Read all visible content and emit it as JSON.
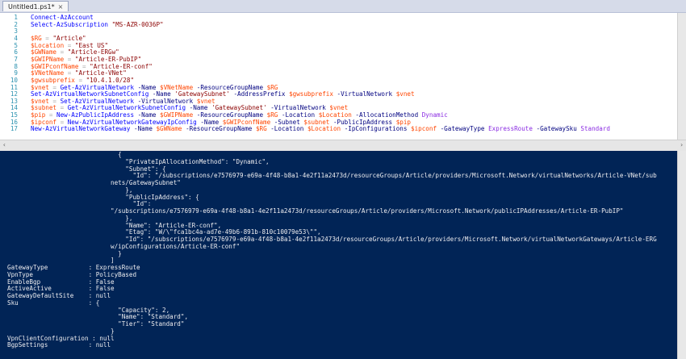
{
  "tab": {
    "title": "Untitled1.ps1*",
    "close": "×"
  },
  "editor_lines": [
    {
      "n": "1",
      "tokens": [
        {
          "c": "cmd",
          "t": "Connect-AzAccount"
        }
      ]
    },
    {
      "n": "2",
      "tokens": [
        {
          "c": "cmd",
          "t": "Select-AzSubscription"
        },
        {
          "c": "",
          "t": " "
        },
        {
          "c": "str",
          "t": "\"MS-AZR-0036P\""
        }
      ]
    },
    {
      "n": "3",
      "tokens": []
    },
    {
      "n": "4",
      "tokens": [
        {
          "c": "var",
          "t": "$RG"
        },
        {
          "c": "op",
          "t": " = "
        },
        {
          "c": "str",
          "t": "\"Article\""
        }
      ]
    },
    {
      "n": "5",
      "tokens": [
        {
          "c": "var",
          "t": "$Location"
        },
        {
          "c": "op",
          "t": " = "
        },
        {
          "c": "str",
          "t": "\"East US\""
        }
      ]
    },
    {
      "n": "6",
      "tokens": [
        {
          "c": "var",
          "t": "$GWName"
        },
        {
          "c": "op",
          "t": " = "
        },
        {
          "c": "str",
          "t": "\"Article-ERGw\""
        }
      ]
    },
    {
      "n": "7",
      "tokens": [
        {
          "c": "var",
          "t": "$GWIPName"
        },
        {
          "c": "op",
          "t": " = "
        },
        {
          "c": "str",
          "t": "\"Article-ER-PubIP\""
        }
      ]
    },
    {
      "n": "8",
      "tokens": [
        {
          "c": "var",
          "t": "$GWIPconfName"
        },
        {
          "c": "op",
          "t": " = "
        },
        {
          "c": "str",
          "t": "\"Article-ER-conf\""
        }
      ]
    },
    {
      "n": "9",
      "tokens": [
        {
          "c": "var",
          "t": "$VNetName"
        },
        {
          "c": "op",
          "t": " = "
        },
        {
          "c": "str",
          "t": "\"Article-VNet\""
        }
      ]
    },
    {
      "n": "10",
      "tokens": [
        {
          "c": "var",
          "t": "$gwsubprefix"
        },
        {
          "c": "op",
          "t": " = "
        },
        {
          "c": "str",
          "t": "\"10.4.1.0/28\""
        }
      ]
    },
    {
      "n": "11",
      "tokens": [
        {
          "c": "var",
          "t": "$vnet"
        },
        {
          "c": "op",
          "t": " = "
        },
        {
          "c": "cmd",
          "t": "Get-AzVirtualNetwork"
        },
        {
          "c": "",
          "t": " "
        },
        {
          "c": "par",
          "t": "-Name"
        },
        {
          "c": "",
          "t": " "
        },
        {
          "c": "var",
          "t": "$VNetName"
        },
        {
          "c": "",
          "t": " "
        },
        {
          "c": "par",
          "t": "-ResourceGroupName"
        },
        {
          "c": "",
          "t": " "
        },
        {
          "c": "var",
          "t": "$RG"
        }
      ]
    },
    {
      "n": "12",
      "tokens": [
        {
          "c": "cmd",
          "t": "Set-AzVirtualNetworkSubnetConfig"
        },
        {
          "c": "",
          "t": " "
        },
        {
          "c": "par",
          "t": "-Name"
        },
        {
          "c": "",
          "t": " "
        },
        {
          "c": "str",
          "t": "'GatewaySubnet'"
        },
        {
          "c": "",
          "t": " "
        },
        {
          "c": "par",
          "t": "-AddressPrefix"
        },
        {
          "c": "",
          "t": " "
        },
        {
          "c": "var",
          "t": "$gwsubprefix"
        },
        {
          "c": "",
          "t": " "
        },
        {
          "c": "par",
          "t": "-VirtualNetwork"
        },
        {
          "c": "",
          "t": " "
        },
        {
          "c": "var",
          "t": "$vnet"
        }
      ]
    },
    {
      "n": "13",
      "tokens": [
        {
          "c": "var",
          "t": "$vnet"
        },
        {
          "c": "op",
          "t": " = "
        },
        {
          "c": "cmd",
          "t": "Set-AzVirtualNetwork"
        },
        {
          "c": "",
          "t": " "
        },
        {
          "c": "par",
          "t": "-VirtualNetwork"
        },
        {
          "c": "",
          "t": " "
        },
        {
          "c": "var",
          "t": "$vnet"
        }
      ]
    },
    {
      "n": "14",
      "tokens": [
        {
          "c": "var",
          "t": "$subnet"
        },
        {
          "c": "op",
          "t": " = "
        },
        {
          "c": "cmd",
          "t": "Get-AzVirtualNetworkSubnetConfig"
        },
        {
          "c": "",
          "t": " "
        },
        {
          "c": "par",
          "t": "-Name"
        },
        {
          "c": "",
          "t": " "
        },
        {
          "c": "str",
          "t": "'GatewaySubnet'"
        },
        {
          "c": "",
          "t": " "
        },
        {
          "c": "par",
          "t": "-VirtualNetwork"
        },
        {
          "c": "",
          "t": " "
        },
        {
          "c": "var",
          "t": "$vnet"
        }
      ]
    },
    {
      "n": "15",
      "tokens": [
        {
          "c": "var",
          "t": "$pip"
        },
        {
          "c": "op",
          "t": " = "
        },
        {
          "c": "cmd",
          "t": "New-AzPublicIpAddress"
        },
        {
          "c": "",
          "t": " "
        },
        {
          "c": "par",
          "t": "-Name"
        },
        {
          "c": "",
          "t": " "
        },
        {
          "c": "var",
          "t": "$GWIPName"
        },
        {
          "c": "",
          "t": " "
        },
        {
          "c": "par",
          "t": "-ResourceGroupName"
        },
        {
          "c": "",
          "t": " "
        },
        {
          "c": "var",
          "t": "$RG"
        },
        {
          "c": "",
          "t": " "
        },
        {
          "c": "par",
          "t": "-Location"
        },
        {
          "c": "",
          "t": " "
        },
        {
          "c": "var",
          "t": "$Location"
        },
        {
          "c": "",
          "t": " "
        },
        {
          "c": "par",
          "t": "-AllocationMethod"
        },
        {
          "c": "",
          "t": " "
        },
        {
          "c": "typ",
          "t": "Dynamic"
        }
      ]
    },
    {
      "n": "16",
      "tokens": [
        {
          "c": "var",
          "t": "$ipconf"
        },
        {
          "c": "op",
          "t": " = "
        },
        {
          "c": "cmd",
          "t": "New-AzVirtualNetworkGatewayIpConfig"
        },
        {
          "c": "",
          "t": " "
        },
        {
          "c": "par",
          "t": "-Name"
        },
        {
          "c": "",
          "t": " "
        },
        {
          "c": "var",
          "t": "$GWIPconfName"
        },
        {
          "c": "",
          "t": " "
        },
        {
          "c": "par",
          "t": "-Subnet"
        },
        {
          "c": "",
          "t": " "
        },
        {
          "c": "var",
          "t": "$subnet"
        },
        {
          "c": "",
          "t": " "
        },
        {
          "c": "par",
          "t": "-PublicIpAddress"
        },
        {
          "c": "",
          "t": " "
        },
        {
          "c": "var",
          "t": "$pip"
        }
      ]
    },
    {
      "n": "17",
      "tokens": [
        {
          "c": "cmd",
          "t": "New-AzVirtualNetworkGateway"
        },
        {
          "c": "",
          "t": " "
        },
        {
          "c": "par",
          "t": "-Name"
        },
        {
          "c": "",
          "t": " "
        },
        {
          "c": "var",
          "t": "$GWName"
        },
        {
          "c": "",
          "t": " "
        },
        {
          "c": "par",
          "t": "-ResourceGroupName"
        },
        {
          "c": "",
          "t": " "
        },
        {
          "c": "var",
          "t": "$RG"
        },
        {
          "c": "",
          "t": " "
        },
        {
          "c": "par",
          "t": "-Location"
        },
        {
          "c": "",
          "t": " "
        },
        {
          "c": "var",
          "t": "$Location"
        },
        {
          "c": "",
          "t": " "
        },
        {
          "c": "par",
          "t": "-IpConfigurations"
        },
        {
          "c": "",
          "t": " "
        },
        {
          "c": "var",
          "t": "$ipconf"
        },
        {
          "c": "",
          "t": " "
        },
        {
          "c": "par",
          "t": "-GatewayType"
        },
        {
          "c": "",
          "t": " "
        },
        {
          "c": "typ",
          "t": "ExpressRoute"
        },
        {
          "c": "",
          "t": " "
        },
        {
          "c": "par",
          "t": "-GatewaySku"
        },
        {
          "c": "",
          "t": " "
        },
        {
          "c": "typ",
          "t": "Standard"
        }
      ]
    }
  ],
  "console_lines": [
    "                              {",
    "                                \"PrivateIpAllocationMethod\": \"Dynamic\",",
    "                                \"Subnet\": {",
    "                                  \"Id\": \"/subscriptions/e7576979-e69a-4f48-b8a1-4e2f11a2473d/resourceGroups/Article/providers/Microsoft.Network/virtualNetworks/Article-VNet/sub",
    "                            nets/GatewaySubnet\"",
    "                                },",
    "                                \"PublicIpAddress\": {",
    "                                  \"Id\":",
    "                            \"/subscriptions/e7576979-e69a-4f48-b8a1-4e2f11a2473d/resourceGroups/Article/providers/Microsoft.Network/publicIPAddresses/Article-ER-PubIP\"",
    "                                },",
    "                                \"Name\": \"Article-ER-conf\",",
    "                                \"Etag\": \"W/\\\"fca1bc4a-ad7e-49b6-891b-810c10079e53\\\"\",",
    "                                \"Id\": \"/subscriptions/e7576979-e69a-4f48-b8a1-4e2f11a2473d/resourceGroups/Article/providers/Microsoft.Network/virtualNetworkGateways/Article-ERG",
    "                            w/ipConfigurations/Article-ER-conf\"",
    "                              }",
    "                            ]",
    "GatewayType           : ExpressRoute",
    "VpnType               : PolicyBased",
    "EnableBgp             : False",
    "ActiveActive          : False",
    "GatewayDefaultSite    : null",
    "Sku                   : {",
    "                              \"Capacity\": 2,",
    "                              \"Name\": \"Standard\",",
    "                              \"Tier\": \"Standard\"",
    "                            }",
    "VpnClientConfiguration : null",
    "BgpSettings           : null"
  ],
  "colors": {
    "console_bg": "#012456",
    "cmdlet": "#0000ff",
    "variable": "#ff4500",
    "string": "#8b0000",
    "parameter": "#000080",
    "type": "#8a2be2",
    "line_number": "#2b91af"
  }
}
